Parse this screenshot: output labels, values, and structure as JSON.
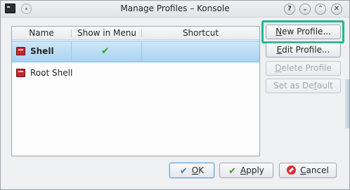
{
  "window": {
    "title": "Manage Profiles – Konsole"
  },
  "titlebar": {
    "help_glyph": "?",
    "minimize_glyph": "⌄",
    "maximize_glyph": "⌃",
    "close_glyph": "✕"
  },
  "table": {
    "columns": [
      "Name",
      "Show in Menu",
      "Shortcut"
    ],
    "rows": [
      {
        "name": "Shell",
        "show_in_menu": "✔",
        "shortcut": "",
        "selected": true,
        "icon": "terminal-icon"
      },
      {
        "name": "Root Shell",
        "show_in_menu": "",
        "shortcut": "",
        "selected": false,
        "icon": "terminal-icon"
      }
    ]
  },
  "side_buttons": {
    "new_profile": "New Profile...",
    "new_profile_u": "N",
    "new_profile_rest": "ew Profile...",
    "edit_profile_u": "E",
    "edit_profile_rest": "dit Profile...",
    "delete_profile_u": "D",
    "delete_profile_rest": "elete Profile",
    "set_default_pre": "Set as De",
    "set_default_u": "f",
    "set_default_post": "ault"
  },
  "dialog_buttons": {
    "ok_u": "O",
    "ok_rest": "K",
    "apply_u": "A",
    "apply_rest": "pply",
    "cancel_u": "C",
    "cancel_rest": "ancel"
  },
  "colors": {
    "highlight": "#1fb897",
    "selection": "#a9d3f2",
    "check": "#3a9d23"
  }
}
